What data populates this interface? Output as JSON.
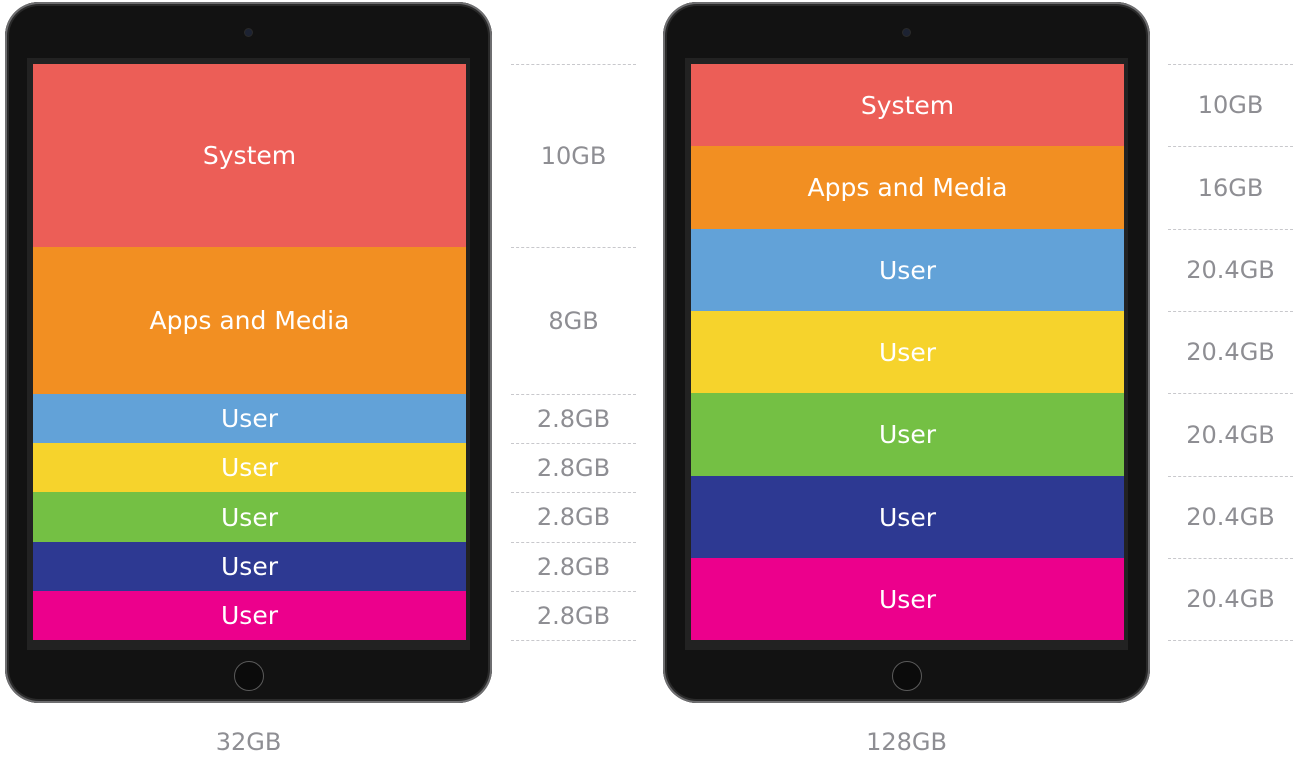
{
  "devices": [
    {
      "capacity": "32GB",
      "segments": [
        {
          "label": "System",
          "size": "10GB",
          "gb": 10,
          "color": "#ec5e57"
        },
        {
          "label": "Apps and Media",
          "size": "8GB",
          "gb": 8,
          "color": "#f28f22"
        },
        {
          "label": "User",
          "size": "2.8GB",
          "gb": 2.8,
          "color": "#62a2d8"
        },
        {
          "label": "User",
          "size": "2.8GB",
          "gb": 2.8,
          "color": "#f6d32c"
        },
        {
          "label": "User",
          "size": "2.8GB",
          "gb": 2.8,
          "color": "#74c044"
        },
        {
          "label": "User",
          "size": "2.8GB",
          "gb": 2.8,
          "color": "#2d3992"
        },
        {
          "label": "User",
          "size": "2.8GB",
          "gb": 2.8,
          "color": "#ec008c"
        }
      ]
    },
    {
      "capacity": "128GB",
      "segments": [
        {
          "label": "System",
          "size": "10GB",
          "gb": 10,
          "color": "#ec5e57"
        },
        {
          "label": "Apps and Media",
          "size": "16GB",
          "gb": 16,
          "color": "#f28f22"
        },
        {
          "label": "User",
          "size": "20.4GB",
          "gb": 20.4,
          "color": "#62a2d8"
        },
        {
          "label": "User",
          "size": "20.4GB",
          "gb": 20.4,
          "color": "#f6d32c"
        },
        {
          "label": "User",
          "size": "20.4GB",
          "gb": 20.4,
          "color": "#74c044"
        },
        {
          "label": "User",
          "size": "20.4GB",
          "gb": 20.4,
          "color": "#2d3992"
        },
        {
          "label": "User",
          "size": "20.4GB",
          "gb": 20.4,
          "color": "#ec008c"
        }
      ]
    }
  ]
}
